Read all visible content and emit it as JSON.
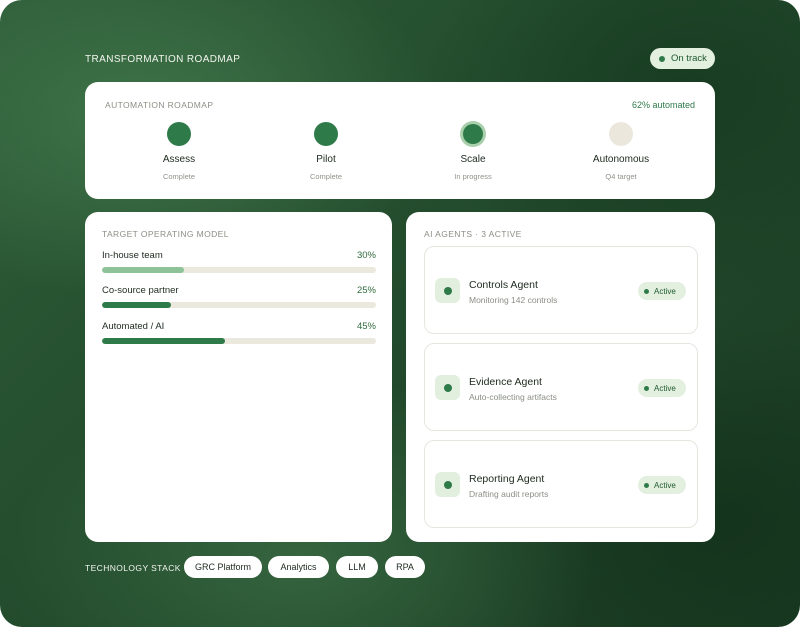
{
  "header": {
    "title": "TRANSFORMATION ROADMAP",
    "status": "On track"
  },
  "roadmap": {
    "label": "AUTOMATION ROADMAP",
    "automated": "62% automated",
    "stages": [
      {
        "name": "Assess",
        "status": "Complete"
      },
      {
        "name": "Pilot",
        "status": "Complete"
      },
      {
        "name": "Scale",
        "status": "In progress"
      },
      {
        "name": "Autonomous",
        "status": "Q4 target"
      }
    ]
  },
  "operating_model": {
    "label": "TARGET OPERATING MODEL",
    "rows": [
      {
        "label": "In-house team",
        "percent_text": "30%",
        "percent": 30,
        "color": "#8ec39a"
      },
      {
        "label": "Co-source partner",
        "percent_text": "25%",
        "percent": 25,
        "color": "#2f7a49"
      },
      {
        "label": "Automated / AI",
        "percent_text": "45%",
        "percent": 45,
        "color": "#2f7a49"
      }
    ]
  },
  "agents": {
    "label": "AI AGENTS · 3 ACTIVE",
    "items": [
      {
        "name": "Controls Agent",
        "description": "Monitoring 142 controls",
        "status": "Active"
      },
      {
        "name": "Evidence Agent",
        "description": "Auto-collecting artifacts",
        "status": "Active"
      },
      {
        "name": "Reporting Agent",
        "description": "Drafting audit reports",
        "status": "Active"
      }
    ]
  },
  "tech_stack": {
    "label": "TECHNOLOGY STACK",
    "items": [
      "GRC Platform",
      "Analytics",
      "LLM",
      "RPA"
    ]
  },
  "colors": {
    "accent": "#2f7a49",
    "light_accent": "#8ec39a",
    "badge_bg": "#e3efdf",
    "track": "#ebe8de"
  }
}
